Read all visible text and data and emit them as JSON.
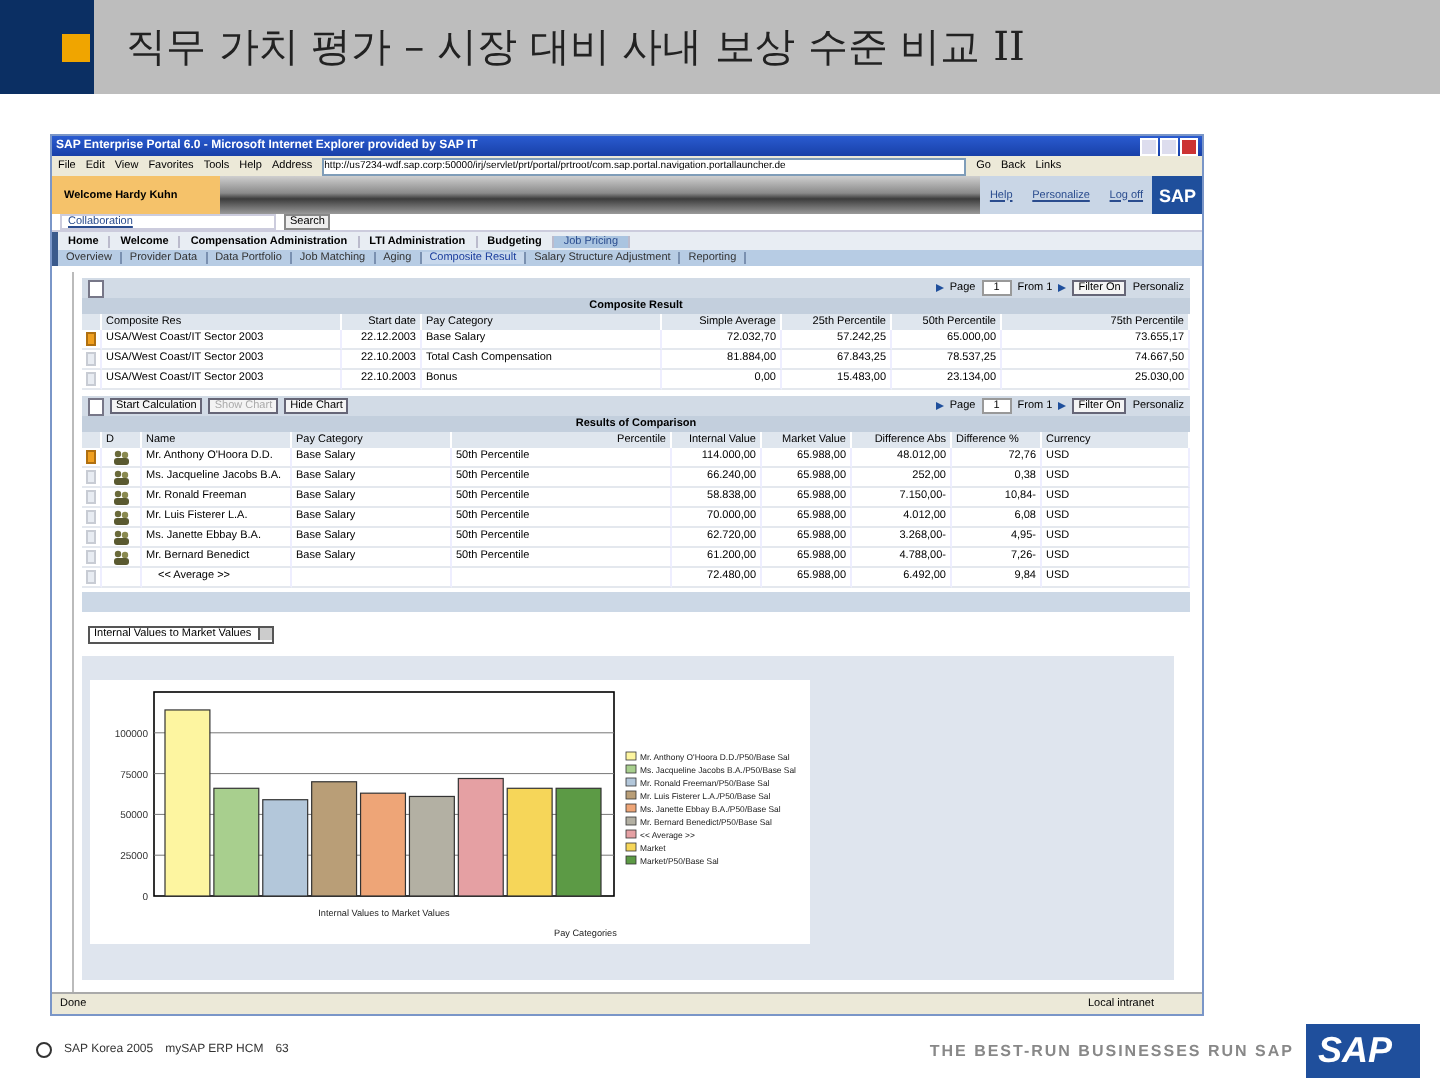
{
  "slide": {
    "title": "직무 가치 평가 – 시장 대비 사내 보상 수준 비교 II",
    "copyright": "SAP Korea 2005",
    "product": "mySAP ERP HCM",
    "page": "63",
    "tagline": "THE BEST-RUN BUSINESSES RUN SAP",
    "logo": "SAP"
  },
  "browser": {
    "title": "SAP Enterprise Portal 6.0 - Microsoft Internet Explorer provided by SAP IT",
    "menu": [
      "File",
      "Edit",
      "View",
      "Favorites",
      "Tools",
      "Help"
    ],
    "address_label": "Address",
    "url": "http://us7234-wdf.sap.corp:50000/irj/servlet/prt/portal/prtroot/com.sap.portal.navigation.portallauncher.de",
    "go": "Go",
    "back": "Back",
    "links": "Links",
    "status": "Done",
    "zone": "Local intranet"
  },
  "portal": {
    "welcome": "Welcome Hardy Kuhn",
    "links": [
      "Help",
      "Personalize",
      "Log off"
    ],
    "logo": "SAP",
    "collaboration": "Collaboration",
    "search": "Search",
    "top_nav": [
      {
        "label": "Home",
        "selected": false
      },
      {
        "label": "Welcome",
        "selected": false
      },
      {
        "label": "Compensation Administration",
        "selected": false
      },
      {
        "label": "LTI Administration",
        "selected": false
      },
      {
        "label": "Budgeting",
        "selected": false
      },
      {
        "label": "Job Pricing",
        "selected": true
      }
    ],
    "sub_nav": [
      {
        "label": "Overview",
        "selected": false
      },
      {
        "label": "Provider Data",
        "selected": false
      },
      {
        "label": "Data Portfolio",
        "selected": false
      },
      {
        "label": "Job Matching",
        "selected": false
      },
      {
        "label": "Aging",
        "selected": false
      },
      {
        "label": "Composite Result",
        "selected": true
      },
      {
        "label": "Salary Structure Adjustment",
        "selected": false
      },
      {
        "label": "Reporting",
        "selected": false
      }
    ]
  },
  "composite": {
    "pager": {
      "page": "Page",
      "page_value": "1",
      "from": "From 1",
      "filter": "Filter On",
      "personalize": "Personaliz"
    },
    "title": "Composite Result",
    "columns": [
      "Composite Res",
      "Start date",
      "Pay Category",
      "Simple Average",
      "25th Percentile",
      "50th Percentile",
      "75th Percentile"
    ],
    "rows": [
      {
        "selected": true,
        "cells": [
          "USA/West Coast/IT Sector 2003",
          "22.12.2003",
          "Base Salary",
          "72.032,70",
          "57.242,25",
          "65.000,00",
          "73.655,17"
        ]
      },
      {
        "selected": false,
        "cells": [
          "USA/West Coast/IT Sector 2003",
          "22.10.2003",
          "Total Cash Compensation",
          "81.884,00",
          "67.843,25",
          "78.537,25",
          "74.667,50"
        ]
      },
      {
        "selected": false,
        "cells": [
          "USA/West Coast/IT Sector 2003",
          "22.10.2003",
          "Bonus",
          "0,00",
          "15.483,00",
          "23.134,00",
          "25.030,00"
        ]
      }
    ]
  },
  "comparison": {
    "buttons": [
      {
        "label": "Start Calculation",
        "disabled": false
      },
      {
        "label": "Show Chart",
        "disabled": true
      },
      {
        "label": "Hide Chart",
        "disabled": false
      }
    ],
    "pager": {
      "page": "Page",
      "page_value": "1",
      "from": "From 1",
      "filter": "Filter On",
      "personalize": "Personaliz"
    },
    "title": "Results of Comparison",
    "columns": [
      "D",
      "Name",
      "Pay Category",
      "Percentile",
      "Internal Value",
      "Market Value",
      "Difference Abs",
      "Difference %",
      "Currency"
    ],
    "rows": [
      {
        "selected": true,
        "kind": "person",
        "cells": [
          "",
          "Mr. Anthony O'Hoora D.D.",
          "Base Salary",
          "50th Percentile",
          "114.000,00",
          "65.988,00",
          "48.012,00",
          "72,76",
          "USD"
        ]
      },
      {
        "selected": false,
        "kind": "person",
        "cells": [
          "",
          "Ms. Jacqueline Jacobs B.A.",
          "Base Salary",
          "50th Percentile",
          "66.240,00",
          "65.988,00",
          "252,00",
          "0,38",
          "USD"
        ]
      },
      {
        "selected": false,
        "kind": "person",
        "cells": [
          "",
          "Mr. Ronald Freeman",
          "Base Salary",
          "50th Percentile",
          "58.838,00",
          "65.988,00",
          "7.150,00-",
          "10,84-",
          "USD"
        ]
      },
      {
        "selected": false,
        "kind": "person",
        "cells": [
          "",
          "Mr. Luis Fisterer L.A.",
          "Base Salary",
          "50th Percentile",
          "70.000,00",
          "65.988,00",
          "4.012,00",
          "6,08",
          "USD"
        ]
      },
      {
        "selected": false,
        "kind": "person",
        "cells": [
          "",
          "Ms. Janette Ebbay B.A.",
          "Base Salary",
          "50th Percentile",
          "62.720,00",
          "65.988,00",
          "3.268,00-",
          "4,95-",
          "USD"
        ]
      },
      {
        "selected": false,
        "kind": "person",
        "cells": [
          "",
          "Mr. Bernard Benedict",
          "Base Salary",
          "50th Percentile",
          "61.200,00",
          "65.988,00",
          "4.788,00-",
          "7,26-",
          "USD"
        ]
      },
      {
        "selected": false,
        "kind": "total",
        "cells": [
          "",
          "<< Average >>",
          "",
          "",
          "72.480,00",
          "65.988,00",
          "6.492,00",
          "9,84",
          "USD"
        ]
      }
    ]
  },
  "chart_select": "Internal Values to Market Values",
  "chart": {
    "chart_data": {
      "type": "bar",
      "title": "Internal Values to Market Values",
      "xlabel": "Pay Categories",
      "ylim": [
        0,
        125000
      ],
      "yticks": [
        0,
        25000,
        50000,
        75000,
        100000
      ],
      "grid": true,
      "legend": true,
      "series": [
        {
          "name": "Mr. Anthony O'Hoora D.D./P50/Base Sal",
          "color": "#fdf5a0",
          "values": [
            114000
          ]
        },
        {
          "name": "Ms. Jacqueline Jacobs B.A./P50/Base Sal",
          "color": "#a8cf8e",
          "values": [
            66000
          ]
        },
        {
          "name": "Mr. Ronald Freeman/P50/Base Sal",
          "color": "#b3c7da",
          "values": [
            59000
          ]
        },
        {
          "name": "Mr. Luis Fisterer L.A./P50/Base Sal",
          "color": "#b99e77",
          "values": [
            70000
          ]
        },
        {
          "name": "Ms. Janette Ebbay B.A./P50/Base Sal",
          "color": "#eea577",
          "values": [
            63000
          ]
        },
        {
          "name": "Mr. Bernard Benedict/P50/Base Sal",
          "color": "#b3b0a3",
          "values": [
            61000
          ]
        },
        {
          "name": "<< Average >>",
          "color": "#e5a0a3",
          "values": [
            72000
          ]
        },
        {
          "name": "Market",
          "color": "#f6d659",
          "values": [
            66000
          ]
        },
        {
          "name": "Market/P50/Base Sal",
          "color": "#5c9a45",
          "values": [
            66000
          ]
        }
      ]
    }
  }
}
